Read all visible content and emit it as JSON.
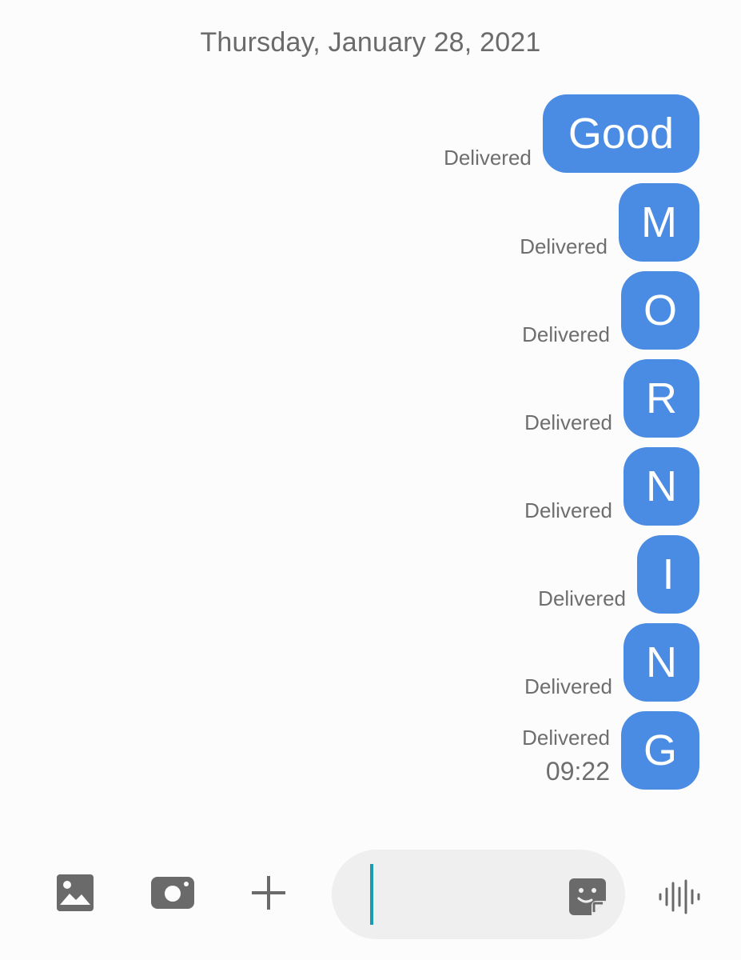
{
  "date_header": "Thursday, January 28, 2021",
  "messages": [
    {
      "text": "Good",
      "status": "Delivered"
    },
    {
      "text": "M",
      "status": "Delivered"
    },
    {
      "text": "O",
      "status": "Delivered"
    },
    {
      "text": "R",
      "status": "Delivered"
    },
    {
      "text": "N",
      "status": "Delivered"
    },
    {
      "text": "I",
      "status": "Delivered"
    },
    {
      "text": "N",
      "status": "Delivered"
    },
    {
      "text": "G",
      "status": "Delivered",
      "time": "09:22"
    }
  ],
  "toolbar": {
    "icons": [
      "image-icon",
      "camera-icon",
      "plus-icon",
      "sticker-icon",
      "voice-icon"
    ],
    "input_value": "",
    "input_placeholder": ""
  },
  "colors": {
    "bubble": "#4a8be3",
    "bubble_text": "#ffffff",
    "meta_text": "#6e6e6e",
    "caret": "#1a9bb4",
    "background": "#fcfcfc"
  }
}
